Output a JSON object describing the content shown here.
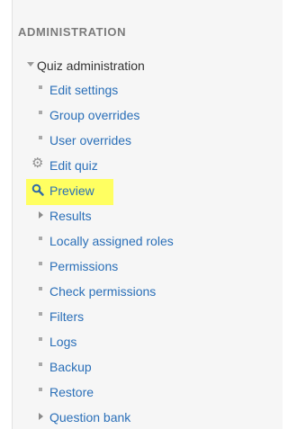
{
  "panel": {
    "title": "ADMINISTRATION",
    "section": {
      "label": "Quiz administration",
      "items": [
        {
          "label": "Edit settings",
          "icon": "bullet"
        },
        {
          "label": "Group overrides",
          "icon": "bullet"
        },
        {
          "label": "User overrides",
          "icon": "bullet"
        },
        {
          "label": "Edit quiz",
          "icon": "gear-icon"
        },
        {
          "label": "Preview",
          "icon": "magnifier-icon",
          "highlighted": true
        },
        {
          "label": "Results",
          "icon": "collapsed-arrow"
        },
        {
          "label": "Locally assigned roles",
          "icon": "bullet"
        },
        {
          "label": "Permissions",
          "icon": "bullet"
        },
        {
          "label": "Check permissions",
          "icon": "bullet"
        },
        {
          "label": "Filters",
          "icon": "bullet"
        },
        {
          "label": "Logs",
          "icon": "bullet"
        },
        {
          "label": "Backup",
          "icon": "bullet"
        },
        {
          "label": "Restore",
          "icon": "bullet"
        },
        {
          "label": "Question bank",
          "icon": "collapsed-arrow"
        }
      ]
    }
  },
  "colors": {
    "link": "#2a6fb8",
    "highlight": "#ffff61",
    "header": "#7b7b7b"
  }
}
